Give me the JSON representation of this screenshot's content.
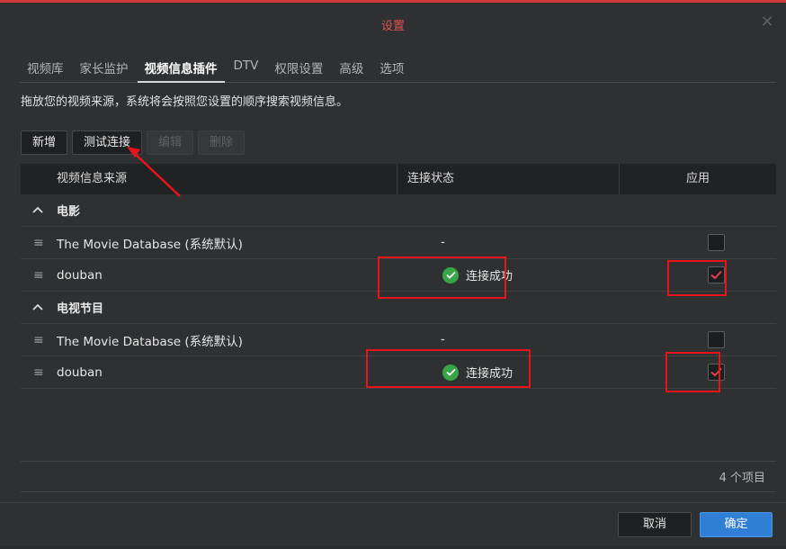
{
  "dialog": {
    "title": "设置"
  },
  "tabs": [
    {
      "label": "视频库"
    },
    {
      "label": "家长监护"
    },
    {
      "label": "视频信息插件",
      "active": true
    },
    {
      "label": "DTV"
    },
    {
      "label": "权限设置"
    },
    {
      "label": "高级"
    },
    {
      "label": "选项"
    }
  ],
  "description": "拖放您的视频来源，系统将会按照您设置的顺序搜索视频信息。",
  "toolbar": {
    "add": "新增",
    "test": "测试连接",
    "edit": "编辑",
    "delete": "删除"
  },
  "table": {
    "headers": {
      "source": "视频信息来源",
      "status": "连接状态",
      "apply": "应用"
    },
    "groups": [
      {
        "name": "电影",
        "rows": [
          {
            "source": "The Movie Database (系统默认)",
            "status": "-",
            "checked": false
          },
          {
            "source": "douban",
            "status": "连接成功",
            "checked": true
          }
        ]
      },
      {
        "name": "电视节目",
        "rows": [
          {
            "source": "The Movie Database (系统默认)",
            "status": "-",
            "checked": false
          },
          {
            "source": "douban",
            "status": "连接成功",
            "checked": true
          }
        ]
      }
    ]
  },
  "footer": {
    "count": "4 个项目"
  },
  "buttons": {
    "cancel": "取消",
    "ok": "确定"
  },
  "colors": {
    "accent": "#2f7fd6",
    "title": "#e0524c",
    "success": "#38a548",
    "annotation": "#e8141a"
  },
  "icons": {
    "close": "close-icon",
    "chevron": "chevron-up-icon",
    "drag": "drag-handle-icon",
    "success": "check-circle-icon"
  }
}
